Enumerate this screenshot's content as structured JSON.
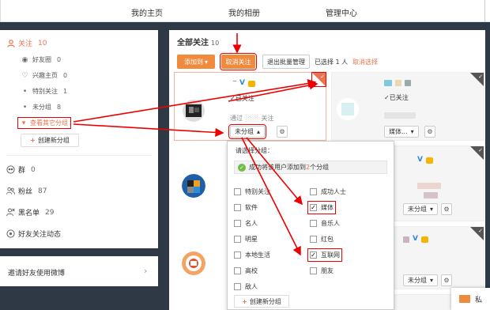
{
  "topnav": {
    "items": [
      "我的主页",
      "我的相册",
      "管理中心"
    ]
  },
  "sidebar": {
    "follow": {
      "label": "关注",
      "count": "10"
    },
    "sub": [
      {
        "label": "好友圈",
        "count": "0"
      },
      {
        "label": "兴趣主页",
        "count": "0"
      },
      {
        "label": "特别关注",
        "count": "1"
      },
      {
        "label": "未分组",
        "count": "8"
      }
    ],
    "more_groups": "查看其它分组",
    "new_group": "创建新分组",
    "others": [
      {
        "label": "群",
        "count": "0"
      },
      {
        "label": "粉丝",
        "count": "87"
      },
      {
        "label": "黑名单",
        "count": "29"
      },
      {
        "label": "好友关注动态",
        "count": ""
      }
    ],
    "invite": "邀请好友使用微博"
  },
  "main": {
    "title": "全部关注",
    "count": "10",
    "toolbar": {
      "add_to": "添加到",
      "unfollow": "取消关注",
      "exit_batch": "退出批量管理",
      "selected_text": "已选择 1 人",
      "cancel_select": "取消选择"
    },
    "cards": [
      {
        "status": "已关注",
        "via": "通过",
        "via_tail": "关注",
        "group": "未分组"
      },
      {
        "status": "已关注",
        "group": "媒体..."
      },
      {
        "group": "未分组"
      },
      {
        "group": "未分组"
      },
      {
        "group": "未分组"
      }
    ],
    "badge_v": "V",
    "dropdown": {
      "tip": "请选择分组：",
      "success_prefix": "成功将该用户添加到",
      "success_count": "2",
      "success_suffix": "个分组",
      "options": [
        {
          "label": "特别关注",
          "checked": false
        },
        {
          "label": "成功人士",
          "checked": false
        },
        {
          "label": "软件",
          "checked": false
        },
        {
          "label": "媒体",
          "checked": true
        },
        {
          "label": "名人",
          "checked": false
        },
        {
          "label": "音乐人",
          "checked": false
        },
        {
          "label": "明星",
          "checked": false
        },
        {
          "label": "红包",
          "checked": false
        },
        {
          "label": "本地生活",
          "checked": false
        },
        {
          "label": "互联网",
          "checked": true
        },
        {
          "label": "高校",
          "checked": false
        },
        {
          "label": "朋友",
          "checked": false
        },
        {
          "label": "敌人",
          "checked": false
        }
      ],
      "new_group": "创建新分组"
    }
  },
  "message_tab": {
    "label": "私"
  },
  "colors": {
    "accent": "#eb7350",
    "orange_button": "#f08a3c",
    "annotation": "#e00000",
    "page_bg": "#2f3845"
  }
}
